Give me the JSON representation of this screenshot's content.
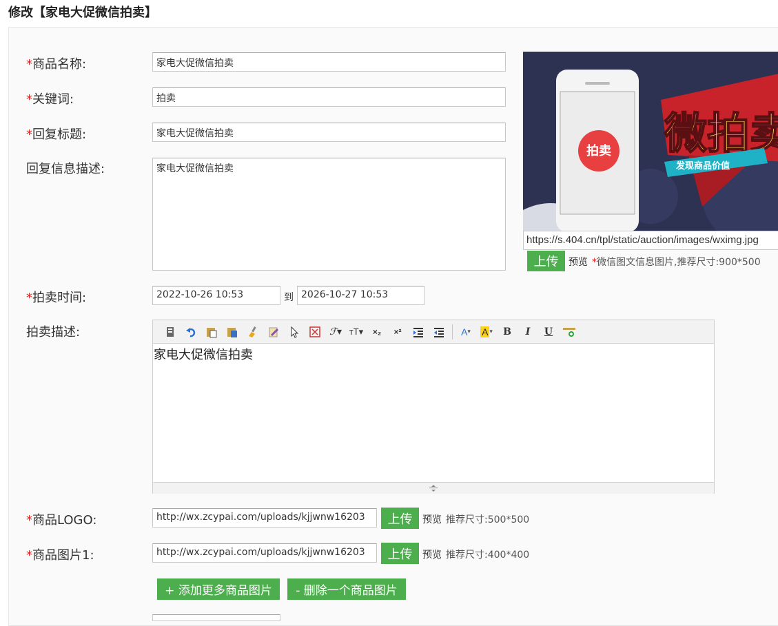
{
  "page": {
    "title": "修改【家电大促微信拍卖】"
  },
  "form": {
    "product_name": {
      "label": "商品名称:",
      "value": "家电大促微信拍卖"
    },
    "keyword": {
      "label": "关键词:",
      "value": "拍卖"
    },
    "reply_title": {
      "label": "回复标题:",
      "value": "家电大促微信拍卖"
    },
    "reply_desc": {
      "label": "回复信息描述:",
      "value": "家电大促微信拍卖"
    },
    "auction_time": {
      "label": "拍卖时间:",
      "start": "2022-10-26 10:53",
      "to": "到",
      "end": "2026-10-27 10:53"
    },
    "auction_desc": {
      "label": "拍卖描述:",
      "content": "家电大促微信拍卖"
    },
    "logo": {
      "label": "商品LOGO:",
      "value": "http://wx.zcypai.com/uploads/kjjwnw16203",
      "upload": "上传",
      "preview": "预览",
      "hint": "推荐尺寸:500*500"
    },
    "image1": {
      "label": "商品图片1:",
      "value": "http://wx.zcypai.com/uploads/kjjwnw16203",
      "upload": "上传",
      "preview": "预览",
      "hint": "推荐尺寸:400*400"
    },
    "add_image": "+ 添加更多商品图片",
    "remove_image": "- 删除一个商品图片",
    "required_mark": "*"
  },
  "cover": {
    "url": "https://s.404.cn/tpl/static/auction/images/wximg.jpg",
    "upload": "上传",
    "preview": "预览",
    "hint": "微信图文信息图片,推荐尺寸:900*500",
    "banner_text": "微拍卖",
    "ribbon_text": "发现商品价值",
    "badge_text": "拍卖"
  },
  "toolbar": {
    "font_color": "A",
    "highlight": "A",
    "bold": "B",
    "italic": "I",
    "underline": "U",
    "subscript": "×₂",
    "superscript": "×²"
  },
  "colors": {
    "accent_green": "#4cae4c",
    "required_red": "#e02020"
  }
}
